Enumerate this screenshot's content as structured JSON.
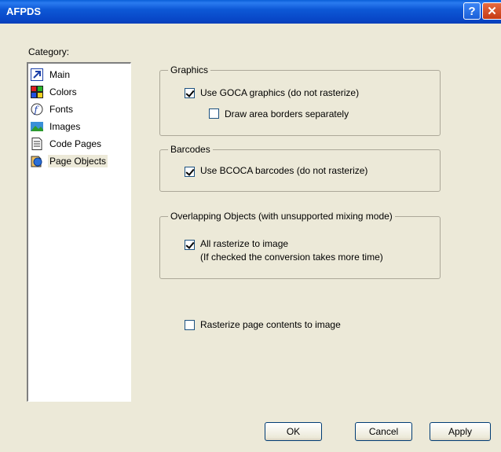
{
  "window": {
    "title": "AFPDS",
    "help_glyph": "?",
    "close_glyph": "✕"
  },
  "category": {
    "label": "Category:",
    "items": [
      {
        "label": "Main",
        "icon": "main-icon"
      },
      {
        "label": "Colors",
        "icon": "colors-icon"
      },
      {
        "label": "Fonts",
        "icon": "fonts-icon"
      },
      {
        "label": "Images",
        "icon": "images-icon"
      },
      {
        "label": "Code Pages",
        "icon": "code-pages-icon"
      },
      {
        "label": "Page Objects",
        "icon": "page-objects-icon",
        "selected": true
      }
    ]
  },
  "graphics": {
    "title": "Graphics",
    "use_goca": {
      "label": "Use GOCA graphics (do not rasterize)",
      "checked": true
    },
    "draw_borders": {
      "label": "Draw area borders separately",
      "checked": false
    }
  },
  "barcodes": {
    "title": "Barcodes",
    "use_bcoca": {
      "label": "Use BCOCA barcodes (do not rasterize)",
      "checked": true
    }
  },
  "overlapping": {
    "title": "Overlapping Objects (with unsupported mixing mode)",
    "rasterize_all": {
      "label": "All rasterize to image",
      "checked": true
    },
    "note": "(If checked the conversion takes more time)"
  },
  "rasterize_page": {
    "label": "Rasterize page contents to image",
    "checked": false
  },
  "buttons": {
    "ok": "OK",
    "cancel": "Cancel",
    "apply": "Apply"
  }
}
